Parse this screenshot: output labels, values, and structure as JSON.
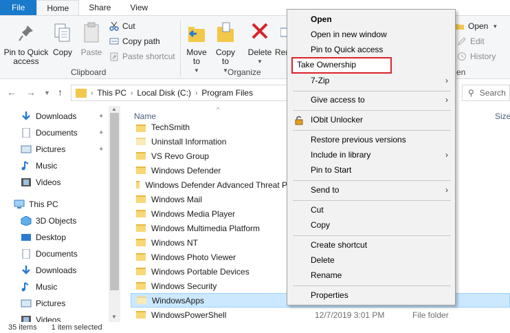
{
  "tabs": [
    {
      "label": "File"
    },
    {
      "label": "Home"
    },
    {
      "label": "Share"
    },
    {
      "label": "View"
    }
  ],
  "ribbon": {
    "pin_to_quick_access": "Pin to Quick access",
    "copy": "Copy",
    "paste": "Paste",
    "cut": "Cut",
    "copy_path": "Copy path",
    "paste_shortcut": "Paste shortcut",
    "clipboard_group": "Clipboard",
    "move_to": "Move to",
    "copy_to": "Copy to",
    "delete": "Delete",
    "rename_partial": "Ren",
    "organize_group": "Organize",
    "open": "Open",
    "edit": "Edit",
    "history": "History",
    "open_group_partial": "en"
  },
  "address": {
    "crumbs": [
      "This PC",
      "Local Disk (C:)",
      "Program Files"
    ],
    "search_placeholder": "Search"
  },
  "nav": {
    "quick": [
      {
        "label": "Downloads",
        "icon": "download-icon"
      },
      {
        "label": "Documents",
        "icon": "documents-icon"
      },
      {
        "label": "Pictures",
        "icon": "pictures-icon"
      },
      {
        "label": "Music",
        "icon": "music-icon"
      },
      {
        "label": "Videos",
        "icon": "videos-icon"
      }
    ],
    "this_pc": "This PC",
    "pc_items": [
      {
        "label": "3D Objects",
        "icon": "3d-objects-icon"
      },
      {
        "label": "Desktop",
        "icon": "desktop-icon"
      },
      {
        "label": "Documents",
        "icon": "documents-icon"
      },
      {
        "label": "Downloads",
        "icon": "download-icon"
      },
      {
        "label": "Music",
        "icon": "music-icon"
      },
      {
        "label": "Pictures",
        "icon": "pictures-icon"
      },
      {
        "label": "Videos",
        "icon": "videos-icon"
      }
    ]
  },
  "filelist": {
    "col_name": "Name",
    "col_size_partial": "Size",
    "rows": [
      {
        "name": "TechSmith"
      },
      {
        "name": "Uninstall Information"
      },
      {
        "name": "VS Revo Group"
      },
      {
        "name": "Windows Defender"
      },
      {
        "name": "Windows Defender Advanced Threat P"
      },
      {
        "name": "Windows Mail"
      },
      {
        "name": "Windows Media Player"
      },
      {
        "name": "Windows Multimedia Platform"
      },
      {
        "name": "Windows NT"
      },
      {
        "name": "Windows Photo Viewer"
      },
      {
        "name": "Windows Portable Devices"
      },
      {
        "name": "Windows Security"
      },
      {
        "name": "WindowsApps"
      },
      {
        "name": "WindowsPowerShell",
        "date": "12/7/2019 3:01 PM",
        "type": "File folder"
      }
    ]
  },
  "status": {
    "items": "35 items",
    "selected": "1 item selected"
  },
  "context_menu": {
    "open": "Open",
    "open_new_window": "Open in new window",
    "pin_quick": "Pin to Quick access",
    "take_ownership": "Take Ownership",
    "seven_zip": "7-Zip",
    "give_access": "Give access to",
    "iobit": "IObit Unlocker",
    "restore": "Restore previous versions",
    "include_library": "Include in library",
    "pin_start": "Pin to Start",
    "send_to": "Send to",
    "cut": "Cut",
    "copy": "Copy",
    "create_shortcut": "Create shortcut",
    "delete": "Delete",
    "rename": "Rename",
    "properties": "Properties"
  },
  "colors": {
    "file_tab": "#1979ca",
    "selection": "#cce8ff",
    "highlight_border": "#d8232a",
    "folder": "#f8d775"
  }
}
